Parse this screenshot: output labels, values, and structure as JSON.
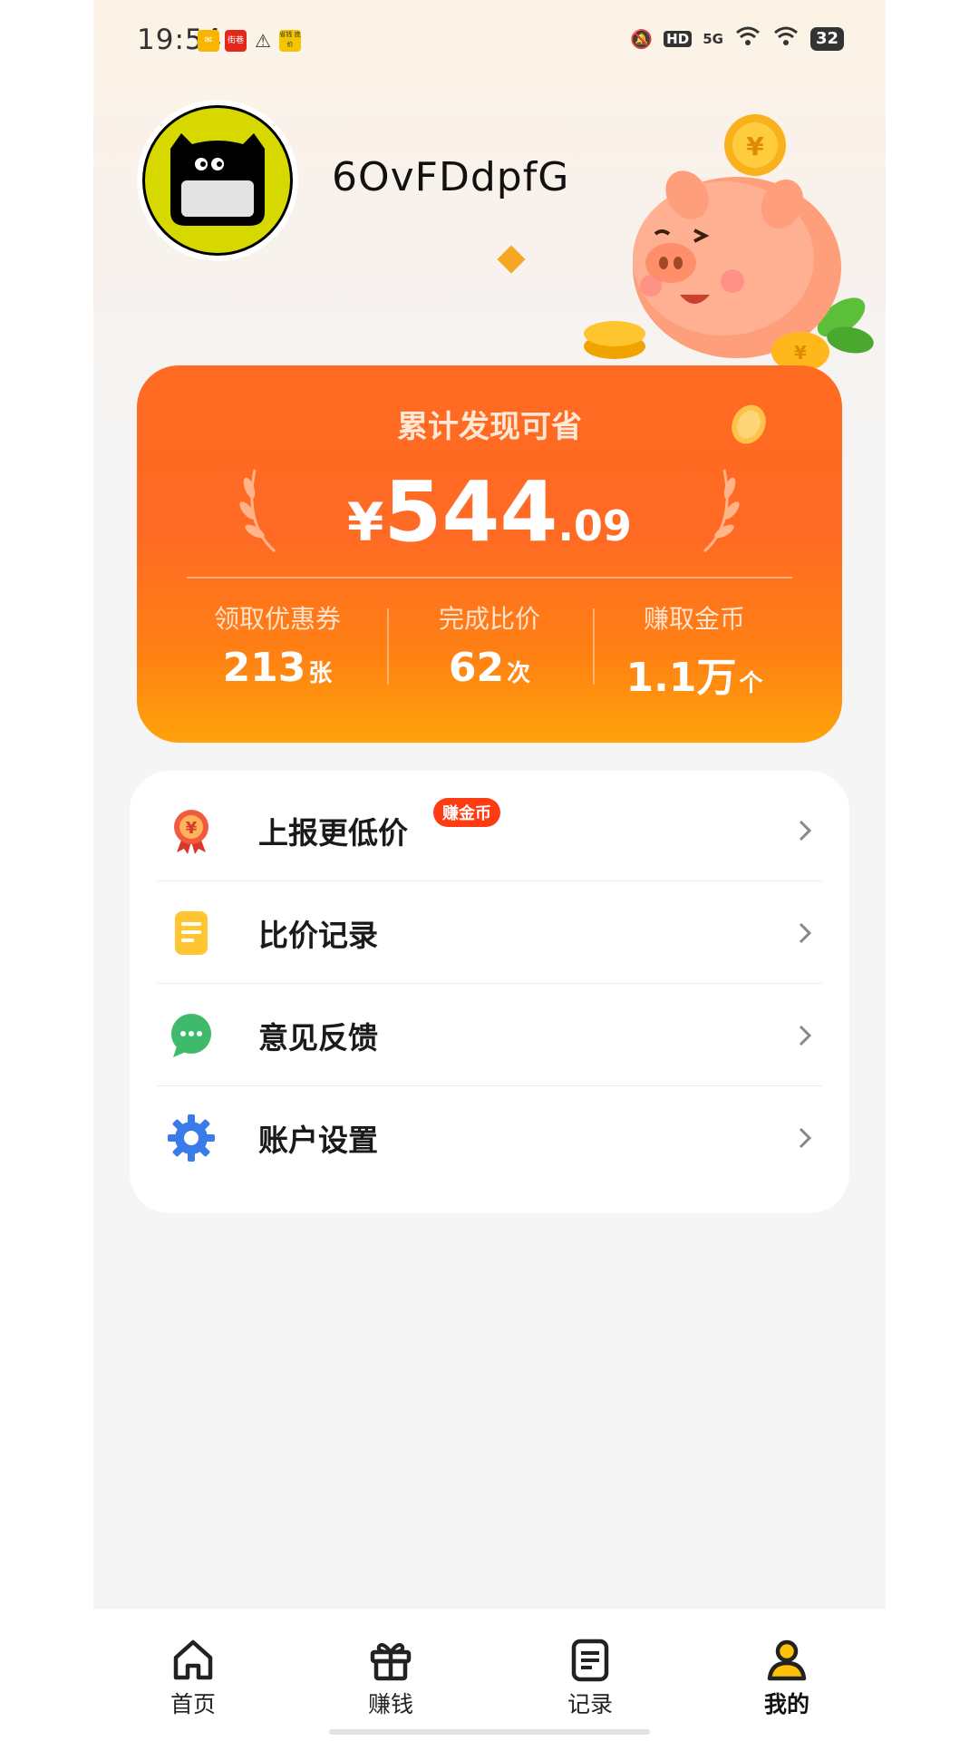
{
  "status_bar": {
    "time": "19:54",
    "notif_icons": [
      "mail-icon",
      "街巷",
      "alert-icon",
      "省钱 底价"
    ],
    "right_icons": [
      "mute-icon",
      "HD",
      "5G",
      "wifi-calling-icon",
      "wifi-icon"
    ],
    "battery": "32"
  },
  "profile": {
    "username": "6OvFDdpfG"
  },
  "savings": {
    "title": "累计发现可省",
    "currency": "¥",
    "amount_int": "544",
    "amount_dec": ".09",
    "stats": [
      {
        "label": "领取优惠券",
        "value": "213",
        "unit": "张"
      },
      {
        "label": "完成比价",
        "value": "62",
        "unit": "次"
      },
      {
        "label": "赚取金币",
        "value": "1.1万",
        "unit": "个"
      }
    ]
  },
  "menu": {
    "items": [
      {
        "label": "上报更低价",
        "badge": "赚金币",
        "icon": "rosette-yen-icon"
      },
      {
        "label": "比价记录",
        "icon": "document-icon"
      },
      {
        "label": "意见反馈",
        "icon": "chat-bubble-icon"
      },
      {
        "label": "账户设置",
        "icon": "gear-icon"
      }
    ]
  },
  "tabbar": {
    "tabs": [
      {
        "label": "首页",
        "icon": "home-icon",
        "active": false
      },
      {
        "label": "赚钱",
        "icon": "gift-icon",
        "active": false
      },
      {
        "label": "记录",
        "icon": "list-document-icon",
        "active": false
      },
      {
        "label": "我的",
        "icon": "person-icon",
        "active": true
      }
    ]
  },
  "colors": {
    "accent_orange": "#ff6b22",
    "active_tab_yellow": "#ffc107",
    "badge_red": "#ff3b12"
  }
}
